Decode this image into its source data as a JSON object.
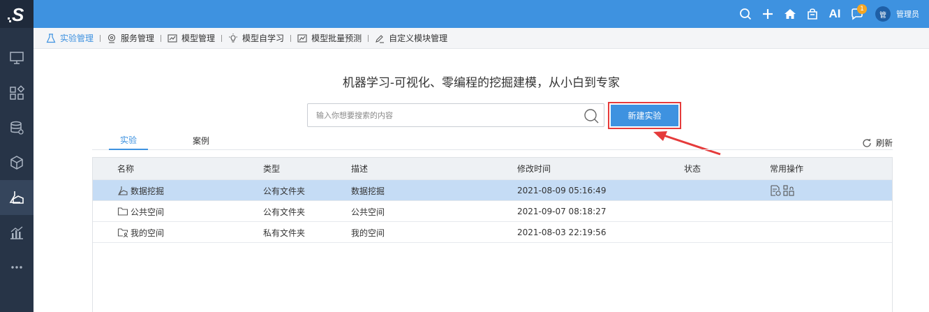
{
  "app": {
    "logo_letter": "S"
  },
  "sidebar": {
    "items": [
      {
        "icon": "monitor-icon"
      },
      {
        "icon": "apps-icon"
      },
      {
        "icon": "database-icon"
      },
      {
        "icon": "cube-icon"
      },
      {
        "icon": "flask-icon",
        "active": true
      },
      {
        "icon": "bar-chart-icon"
      },
      {
        "icon": "more-icon"
      }
    ]
  },
  "topbar": {
    "ai_label": "AI",
    "notification_count": "1",
    "avatar_text": "管",
    "username": "管理员"
  },
  "subnav": {
    "items": [
      {
        "label": "实验管理",
        "active": true
      },
      {
        "label": "服务管理"
      },
      {
        "label": "模型管理"
      },
      {
        "label": "模型自学习"
      },
      {
        "label": "模型批量预测"
      },
      {
        "label": "自定义模块管理"
      }
    ]
  },
  "main": {
    "headline": "机器学习-可视化、零编程的挖掘建模，从小白到专家",
    "search_placeholder": "输入你想要搜索的内容",
    "new_button": "新建实验",
    "tabs": [
      {
        "label": "实验"
      },
      {
        "label": "案例"
      }
    ],
    "refresh_label": "刷新"
  },
  "table": {
    "headers": [
      "名称",
      "类型",
      "描述",
      "修改时间",
      "状态",
      "常用操作"
    ],
    "rows": [
      {
        "name": "数据挖掘",
        "type": "公有文件夹",
        "desc": "数据挖掘",
        "time": "2021-08-09 05:16:49",
        "status": "",
        "icon": "flask-icon"
      },
      {
        "name": "公共空间",
        "type": "公有文件夹",
        "desc": "公共空间",
        "time": "2021-09-07 08:18:27",
        "status": "",
        "icon": "folder-icon"
      },
      {
        "name": "我的空间",
        "type": "私有文件夹",
        "desc": "我的空间",
        "time": "2021-08-03 22:19:56",
        "status": "",
        "icon": "private-folder-icon"
      }
    ]
  },
  "colors": {
    "accent": "#3e92e0",
    "sidebar": "#273447",
    "highlight": "#e53b3b",
    "selected_row": "#c5dcf5"
  }
}
